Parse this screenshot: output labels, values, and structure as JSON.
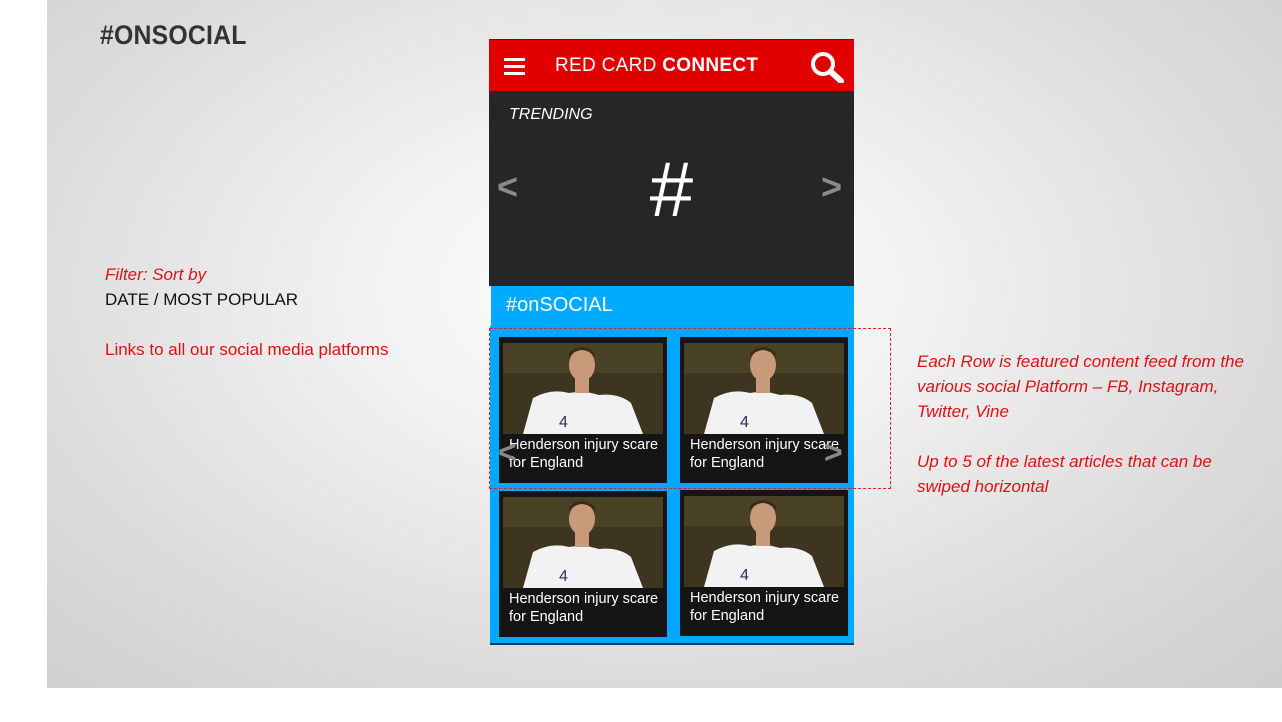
{
  "slide": {
    "title": "#ONSOCIAL",
    "filter_label": "Filter: Sort by",
    "filter_value": "DATE / MOST POPULAR",
    "links_note": "Links to all our social media platforms",
    "row_note": "Each Row is featured content feed from the various social Platform – FB, Instagram, Twitter, Vine",
    "articles_note": "Up to 5 of the latest articles that can be swiped horizontal"
  },
  "app": {
    "title_regular": "RED CARD",
    "title_bold": "CONNECT",
    "menu_icon": "hamburger-menu-icon",
    "search_icon": "search-icon",
    "brand_color": "#e00000"
  },
  "trending": {
    "label": "TRENDING",
    "hashtag_glyph": "#",
    "prev_arrow": "<",
    "next_arrow": ">"
  },
  "social": {
    "title": "#onSOCIAL",
    "accent_color": "#00aaff",
    "prev_arrow": "<",
    "next_arrow": ">",
    "cards": [
      {
        "caption": "Henderson injury scare for England"
      },
      {
        "caption": "Henderson injury scare for England"
      },
      {
        "caption": "Henderson injury scare for England"
      },
      {
        "caption": "Henderson injury scare for England"
      }
    ]
  }
}
